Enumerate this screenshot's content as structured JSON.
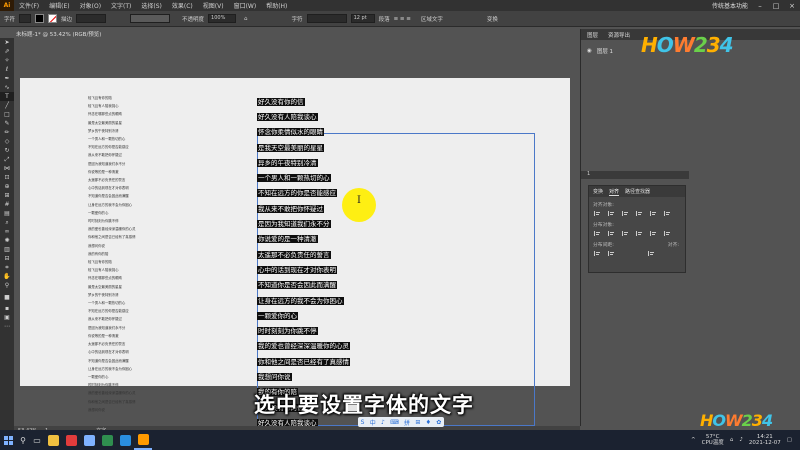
{
  "menubar": {
    "logo": "Ai",
    "items": [
      "文件(F)",
      "编辑(E)",
      "对象(O)",
      "文字(T)",
      "选择(S)",
      "效果(C)",
      "视图(V)",
      "窗口(W)",
      "帮助(H)"
    ],
    "workspace": "传统基本功能",
    "window_controls": [
      "–",
      "□",
      "×"
    ]
  },
  "controlbar": {
    "mode": "字符",
    "stroke_label": "描边",
    "opacity_label": "不透明度",
    "opacity_value": "100%",
    "char_label": "字符",
    "font_size": "12 pt",
    "para_label": "段落",
    "area_type_label": "区域文字",
    "transform_label": "变换"
  },
  "document": {
    "tab_title": "未标题-1* @ 53.42% (RGB/预览)"
  },
  "canvas": {
    "left_column_lines": [
      "轻飞且有你的陪",
      "轻飞且有人陪我挑心",
      "怀念在哪那些点的眼睛",
      "最是太空最美丽的星星",
      "梦乡的午夜特别冷清",
      "一个男人和一颗热切的心",
      "不知在远方的你是否能感应",
      "我从来不敢把你怀疑过",
      "是因为我知道我们永不分",
      "你说等的是一种清澈",
      "太遥那不必负责任的誓言",
      "心中的话到现在才对你表明",
      "不知道你是否会因此而满醒",
      "让身在远方的我不会为你困心",
      "一颗爱你的心",
      "时时刻刻为你跳不停",
      "我的爱也曾经深深温暖你的心灵",
      "你和他之间是否已经有了真感情",
      "我想问你说",
      "我的有你的陪",
      "轻飞且有你的陪",
      "轻飞且有人陪我挑心",
      "怀念在哪那些点的眼睛",
      "最是太空最美丽的星星",
      "梦乡的午夜特别冷清",
      "一个男人和一颗热切的心",
      "不知在远方的你是否能感应",
      "我从来不敢把你怀疑过",
      "是因为我知道我们永不分",
      "你说等的是一种清澈",
      "太遥那不必负责任的誓言",
      "心中的话到现在才对你表明",
      "不知道你是否会因此而满醒",
      "让身在远方的我不会为你困心",
      "一颗爱你的心",
      "时时刻刻为你跳不停",
      "我的爱也曾经深深温暖你的心灵",
      "你和他之间是否已经有了真感情",
      "我想问你说"
    ],
    "right_column_lines": [
      "好久没有你的信",
      "好久没有人陪我谈心",
      "怀念你柔情似水的眼睛",
      "是我天空最美丽的星星",
      "异乡的午夜特别冷清",
      "一个男人和一颗热切的心",
      "不知在远方的你是否能感应",
      "我从来不敢把你怀疑过",
      "是因为我知道我们永不分",
      "你说爱的是一种清澈",
      "太遥那不必负责任的誓言",
      "心中的话到现在才对你表明",
      "不知道你是否会因此而满醒",
      "让身在远方的我不会为你困心",
      "一颗爱你的心",
      "时时刻刻为你跳不停",
      "我的爱也曾经深深温暖你的心灵",
      "你和他之间是否已经有了真感情",
      "我想问你说",
      "我的有你的陪",
      "好久没有你的信",
      "好久没有人陪我谈心"
    ]
  },
  "subtitle": "选中要设置字体的文字",
  "statusbar": {
    "zoom": "53.42%",
    "page": "1",
    "tool": "文字"
  },
  "panels": {
    "tabs": [
      "图层",
      "资源导出"
    ],
    "layer_name": "图层 1",
    "layer_count": "1",
    "align": {
      "tabs": [
        "变换",
        "对齐",
        "路径查找器"
      ],
      "align_objects": "对齐对象:",
      "distribute_objects": "分布对象:",
      "distribute_spacing": "分布间距:",
      "align_to": "对齐:"
    }
  },
  "brand": {
    "letters": [
      "H",
      "O",
      "W",
      "2",
      "3",
      "4"
    ],
    "colors": [
      "#ffb000",
      "#40c4e8",
      "#ff7c30",
      "#6ad04a",
      "#ffb000",
      "#40c4e8"
    ]
  },
  "float_toolbar": [
    "S",
    "中",
    "♪",
    "⌨",
    "拼",
    "⊞",
    "♦",
    "✿"
  ],
  "taskbar": {
    "apps": [
      {
        "name": "file-explorer",
        "color": "#f0c040"
      },
      {
        "name": "recorder",
        "color": "#e23c3c"
      },
      {
        "name": "media",
        "color": "#7fb2ff"
      },
      {
        "name": "app-green",
        "color": "#2f8f4f"
      },
      {
        "name": "app-edge",
        "color": "#2a8fe0"
      },
      {
        "name": "illustrator",
        "color": "#ff9a00"
      }
    ],
    "temperature": "57°C",
    "cpu_label": "CPU温度",
    "time": "14:21",
    "date": "2021-12-07"
  }
}
